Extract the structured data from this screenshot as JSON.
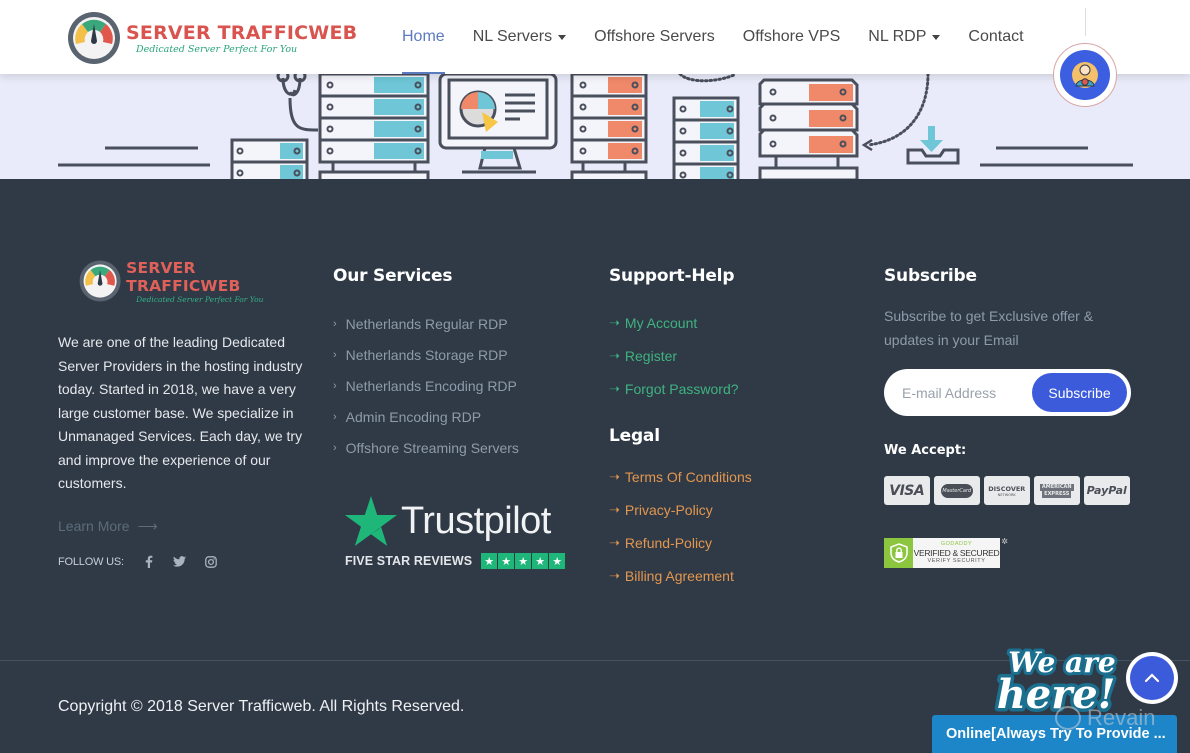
{
  "brand": {
    "name": "SERVER TRAFFICWEB",
    "tagline": "Dedicated Server Perfect For You"
  },
  "nav": {
    "items": [
      {
        "label": "Home",
        "active": true,
        "dropdown": false
      },
      {
        "label": "NL Servers",
        "active": false,
        "dropdown": true
      },
      {
        "label": "Offshore Servers",
        "active": false,
        "dropdown": false
      },
      {
        "label": "Offshore VPS",
        "active": false,
        "dropdown": false
      },
      {
        "label": "NL RDP",
        "active": false,
        "dropdown": true
      },
      {
        "label": "Contact",
        "active": false,
        "dropdown": false
      }
    ],
    "support_icon": "support-agent-icon"
  },
  "footer": {
    "about": {
      "text": "We are one of the leading Dedicated Server Providers in the hosting industry today. Started in 2018, we have a very large customer base. We specialize in Unmanaged Services. Each day, we try and improve the experience of our customers.",
      "learn_more": "Learn More",
      "learn_more_icon": "arrow-right-icon",
      "follow_label": "FOLLOW US:",
      "social": [
        "facebook-icon",
        "twitter-icon",
        "instagram-icon"
      ]
    },
    "services": {
      "title": "Our Services",
      "items": [
        "Netherlands Regular RDP",
        "Netherlands Storage RDP",
        "Netherlands Encoding RDP",
        "Admin Encoding RDP",
        "Offshore Streaming Servers"
      ]
    },
    "trustpilot": {
      "word": "Trustpilot",
      "reviews": "FIVE STAR REVIEWS",
      "stars": 5
    },
    "support": {
      "title": "Support-Help",
      "items": [
        "My Account",
        "Register",
        "Forgot Password?"
      ]
    },
    "legal": {
      "title": "Legal",
      "items": [
        "Terms Of Conditions",
        "Privacy-Policy",
        "Refund-Policy",
        "Billing Agreement"
      ]
    },
    "subscribe": {
      "title": "Subscribe",
      "text": "Subscribe to get Exclusive offer & updates in your Email",
      "placeholder": "E-mail Address",
      "button": "Subscribe",
      "accept_title": "We Accept:",
      "cards": {
        "visa": "VISA",
        "mastercard": "MasterCard",
        "discover": "DISCOVER",
        "discover_sub": "NETWORK",
        "amex_1": "AMERICAN",
        "amex_2": "EXPRESS",
        "paypal": "PayPal"
      },
      "godaddy": {
        "line1": "GODADDY",
        "line2": "VERIFIED & SECURED",
        "line3": "VERIFY SECURITY"
      }
    },
    "copyright": "Copyright © 2018 Server Trafficweb. All Rights Reserved."
  },
  "widgets": {
    "chat_status": "Online[Always Try To Provide ...",
    "we_are_line1": "We are",
    "we_are_line2": "here!",
    "back_to_top_icon": "chevron-up-icon",
    "watermark": "Revain"
  },
  "colors": {
    "footer_bg": "#2f3a46",
    "hero_bg": "#e9ebfa",
    "nav_active": "#5b7bbf",
    "support_link": "#3fb37f",
    "legal_link": "#e3964f",
    "accent_blue": "#3b5bdb",
    "chat_blue": "#1d86c9",
    "brand_red": "#d9534f",
    "brand_green": "#2aa57a",
    "trustpilot_green": "#1fb67a"
  }
}
